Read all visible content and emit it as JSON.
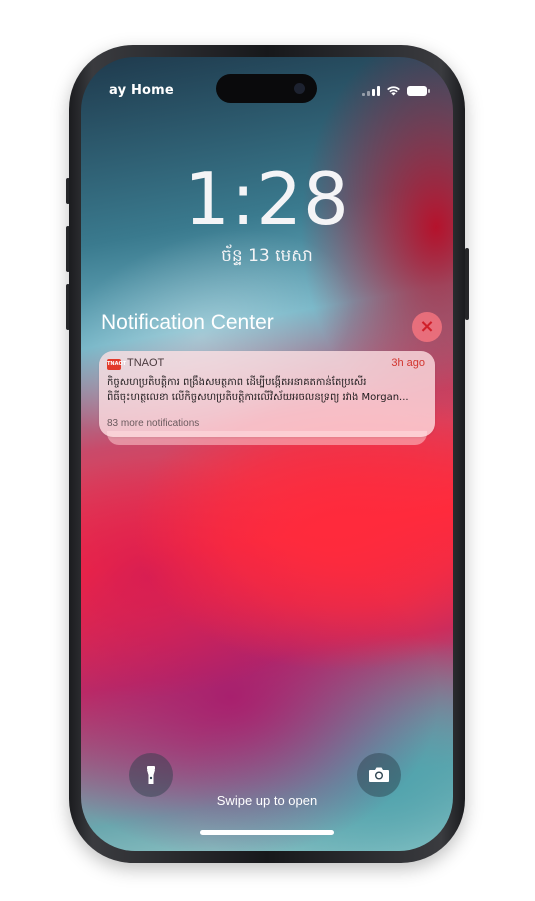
{
  "status_bar": {
    "carrier": "ay Home",
    "signal_bars_active": 2,
    "battery_level": 1.0
  },
  "lock_screen": {
    "time": "1:28",
    "date": "ច័ន្ទ 13 មេសា",
    "swipe_text": "Swipe up to open"
  },
  "notification_center": {
    "title": "Notification Center",
    "close_icon": "×"
  },
  "notification": {
    "app_icon_text": "TNAOT",
    "app_name": "TNAOT",
    "time": "3h ago",
    "body_line1": "កិច្ចសហប្រតិបត្តិការ ពង្រឹងសមត្ថភាព ដើម្បីបង្កើតអនាគតកាន់តែប្រសើរ",
    "body_line2": "ពិធីចុះហត្ថលេខា លើកិច្ចសហប្រតិបត្តិការលើវិស័យអចលនទ្រព្យ រវាង Morgan...",
    "more": "83 more notifications"
  },
  "controls": {
    "flashlight_icon": "flashlight-icon",
    "camera_icon": "camera-icon"
  },
  "colors": {
    "accent_red": "#d2352f",
    "close_bg": "#ff7882"
  }
}
